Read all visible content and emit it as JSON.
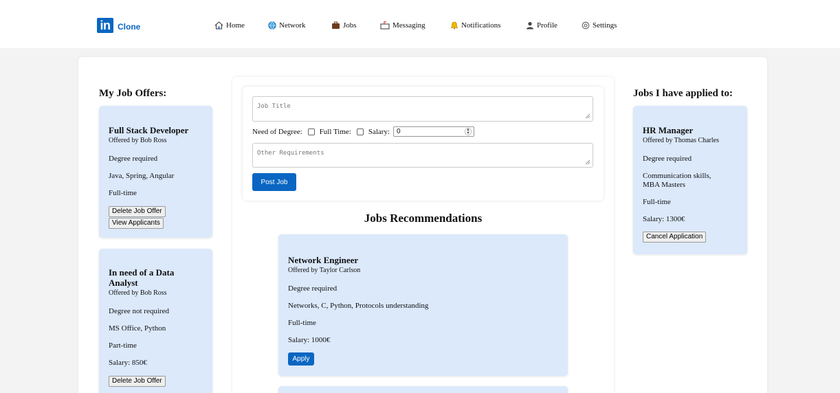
{
  "brand": {
    "logo_text": "in",
    "name": "Clone"
  },
  "nav": [
    {
      "label": "Home",
      "icon": "home-icon"
    },
    {
      "label": "Network",
      "icon": "globe-icon"
    },
    {
      "label": "Jobs",
      "icon": "briefcase-icon"
    },
    {
      "label": "Messaging",
      "icon": "messaging-icon"
    },
    {
      "label": "Notifications",
      "icon": "bell-icon"
    },
    {
      "label": "Profile",
      "icon": "person-icon"
    },
    {
      "label": "Settings",
      "icon": "gear-icon"
    }
  ],
  "my_offers": {
    "heading": "My Job Offers:",
    "items": [
      {
        "title": "Full Stack Developer",
        "by": "Offered by Bob Ross",
        "degree": "Degree required",
        "skills": "Java, Spring, Angular",
        "type": "Full-time",
        "delete_label": "Delete Job Offer",
        "view_label": "View Applicants"
      },
      {
        "title": "In need of a Data Analyst",
        "by": "Offered by Bob Ross",
        "degree": "Degree not required",
        "skills": "MS Office, Python",
        "type": "Part-time",
        "salary": "Salary: 850€",
        "delete_label": "Delete Job Offer"
      }
    ]
  },
  "post_form": {
    "title_placeholder": "Job Title",
    "degree_label": "Need of Degree:",
    "fulltime_label": "Full Time:",
    "salary_label": "Salary:",
    "salary_value": "0",
    "requirements_placeholder": "Other Requirements",
    "post_label": "Post Job"
  },
  "recommendations": {
    "heading": "Jobs Recommendations",
    "items": [
      {
        "title": "Network Engineer",
        "by": "Offered by Taylor Carlson",
        "degree": "Degree required",
        "skills": "Networks, C, Python, Protocols understanding",
        "type": "Full-time",
        "salary": "Salary: 1000€",
        "apply_label": "Apply"
      }
    ]
  },
  "applied": {
    "heading": "Jobs I have applied to:",
    "items": [
      {
        "title": "HR Manager",
        "by": "Offered by Thomas Charles",
        "degree": "Degree required",
        "skills": "Communication skills, MBA Masters",
        "type": "Full-time",
        "salary": "Salary: 1300€",
        "cancel_label": "Cancel Application"
      }
    ]
  },
  "colors": {
    "brand": "#0a66c2",
    "card_bg": "#dce9fb",
    "page_bg": "#f3f3f3"
  }
}
